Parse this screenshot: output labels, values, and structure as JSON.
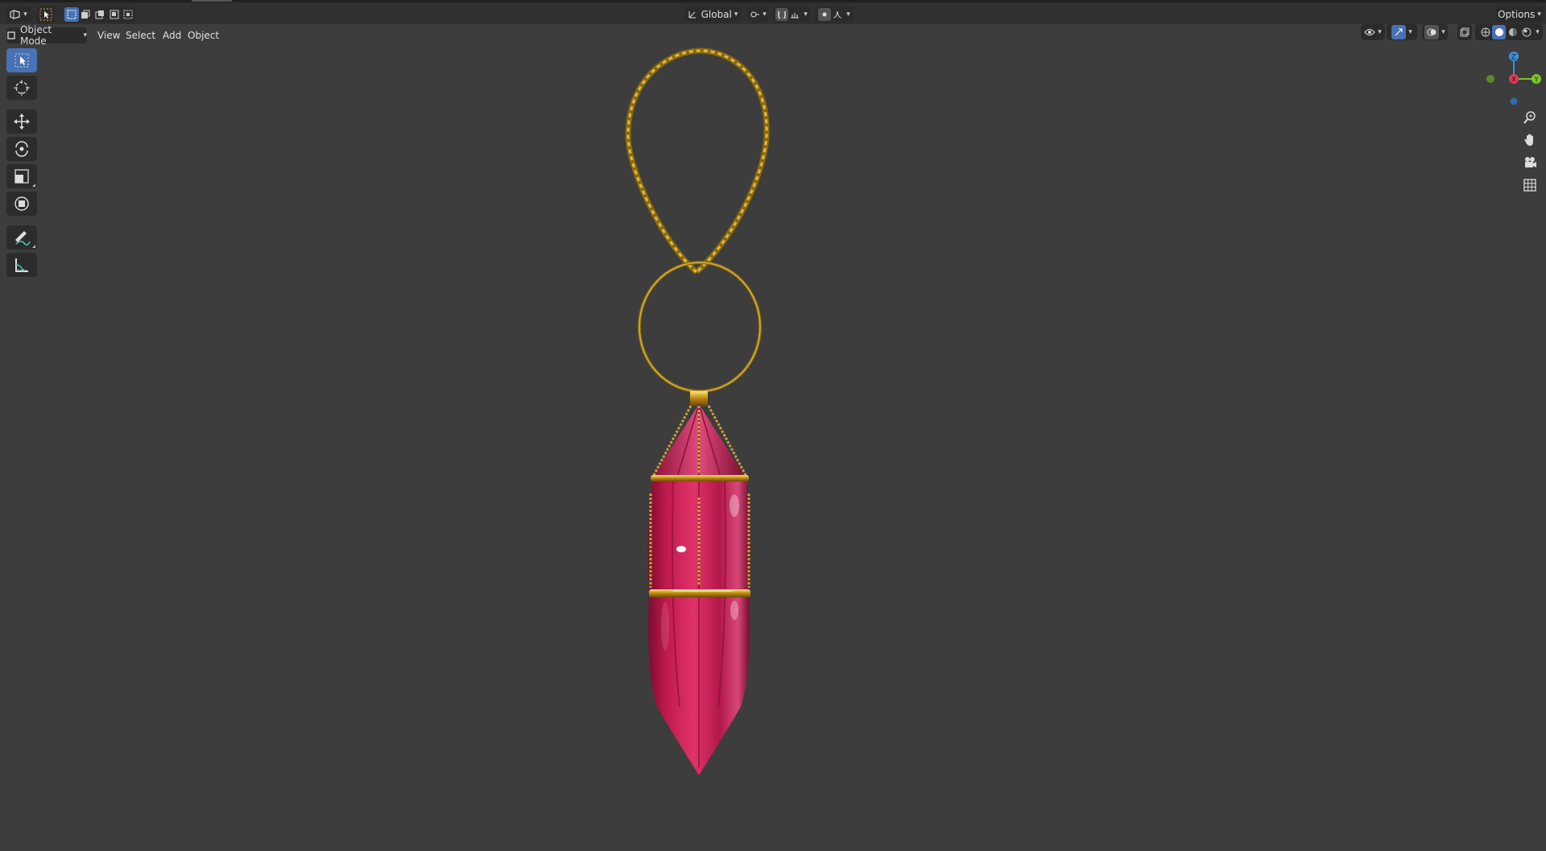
{
  "header": {
    "transform_orientation": "Global",
    "options_label": "Options"
  },
  "menubar": {
    "mode_label": "Object Mode",
    "menus": [
      "View",
      "Select",
      "Add",
      "Object"
    ]
  },
  "toolbar": {
    "tools": [
      "select-box",
      "cursor",
      "move",
      "rotate",
      "scale",
      "transform",
      "annotate",
      "measure"
    ],
    "active": "select-box"
  },
  "viewport": {
    "background": "#3d3d3d",
    "object": "hanging lantern",
    "colors": {
      "glass": "#c01a4e",
      "metal": "#b8860b"
    }
  },
  "gizmo": {
    "axes": {
      "x": "X",
      "y": "Y",
      "z": "Z"
    },
    "colors": {
      "x": "#e03a5c",
      "y": "#7dc62b",
      "z": "#3b8fe0"
    }
  },
  "accent": "#4772b3"
}
